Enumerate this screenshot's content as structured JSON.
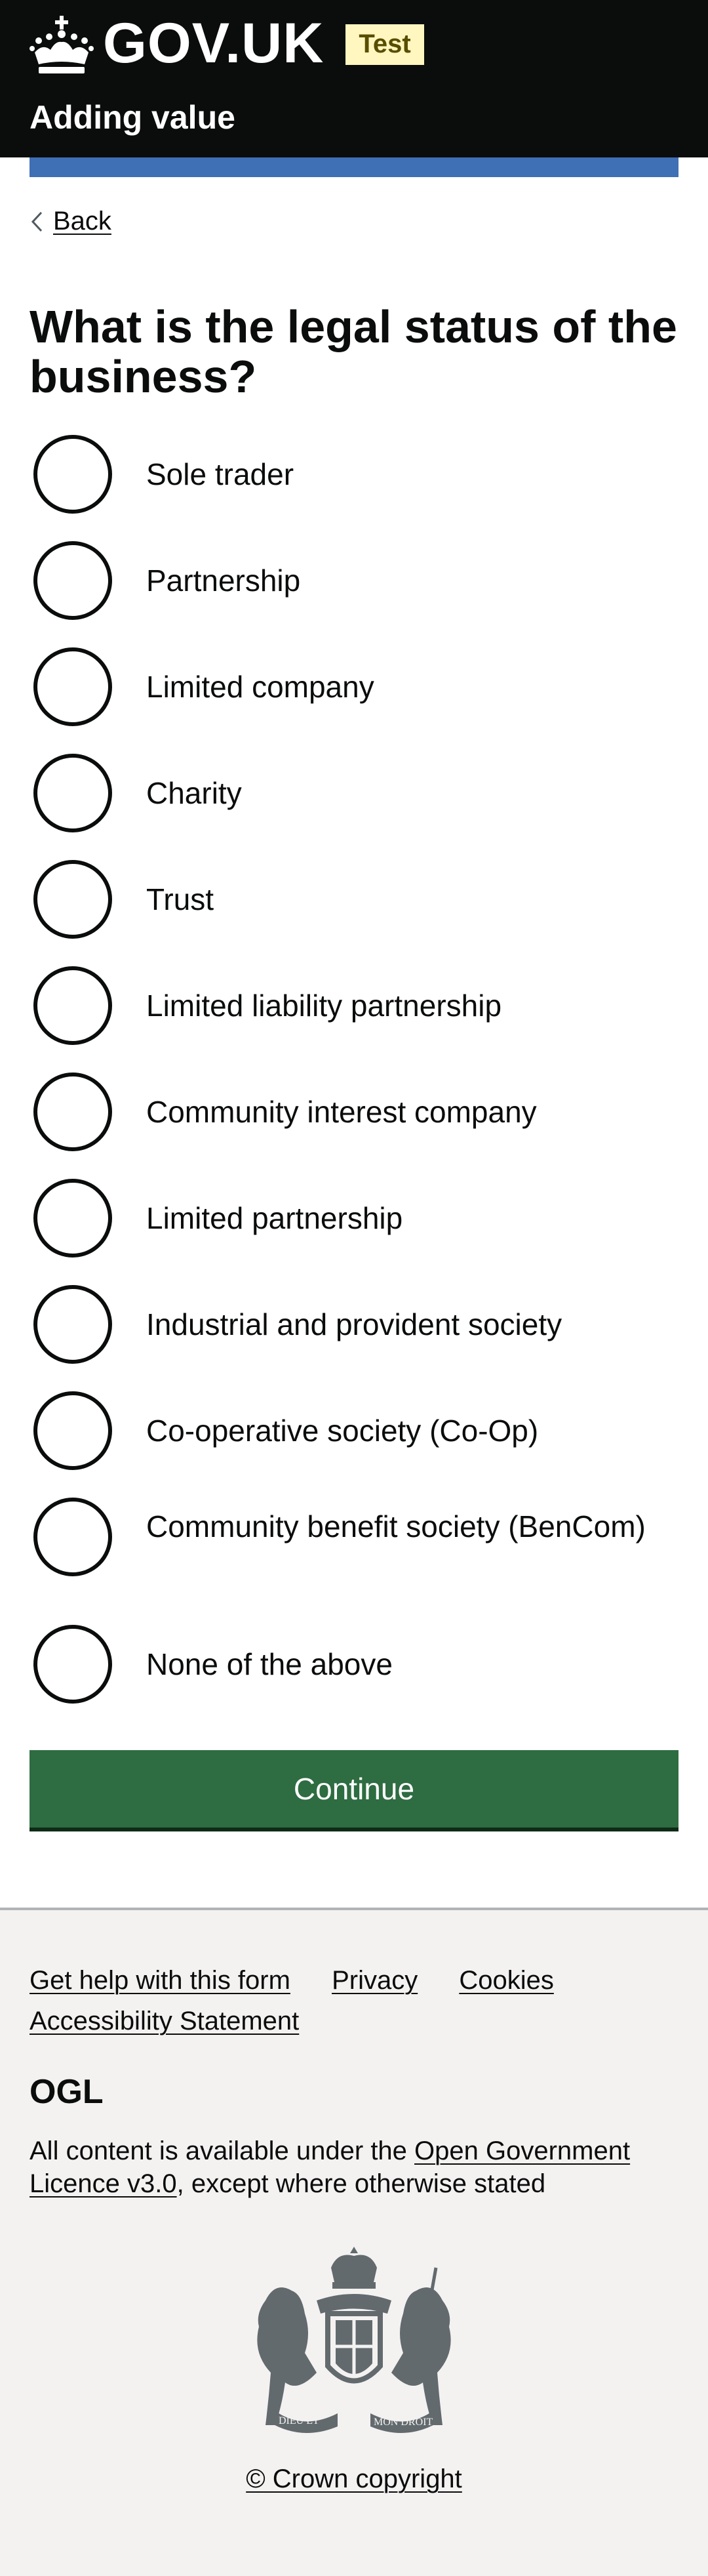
{
  "header": {
    "logotype": "GOV.UK",
    "phase_tag": "Test",
    "service_name": "Adding value"
  },
  "back_link": {
    "label": "Back"
  },
  "question": {
    "title": "What is the legal status of the business?"
  },
  "radios": {
    "options": [
      "Sole trader",
      "Partnership",
      "Limited company",
      "Charity",
      "Trust",
      "Limited liability partnership",
      "Community interest company",
      "Limited partnership",
      "Industrial and provident society",
      "Co-operative society (Co-Op)",
      "Community benefit society (BenCom)",
      "None of the above"
    ]
  },
  "continue_button": {
    "label": "Continue"
  },
  "footer": {
    "links": [
      "Get help with this form",
      "Privacy",
      "Cookies",
      "Accessibility Statement"
    ],
    "ogl_label": "OGL",
    "licence_prefix": "All content is available under the ",
    "licence_link": "Open Government Licence v3.0",
    "licence_suffix": ", except where otherwise stated",
    "crest_motto_left": "DIEU ET",
    "crest_motto_right": "MON DROIT",
    "crest_garter": "HONI SOIT QUI MAL Y PENSE",
    "copyright": "© Crown copyright"
  },
  "colors": {
    "header_bg": "#0b0c0c",
    "accent_bar": "#3f6fb4",
    "button_green": "#2e6c41",
    "tag_bg": "#fff7bf",
    "footer_bg": "#f3f2f1"
  },
  "icons": [
    "crown-icon",
    "back-chevron-icon",
    "ogl-icon",
    "royal-crest-icon"
  ]
}
